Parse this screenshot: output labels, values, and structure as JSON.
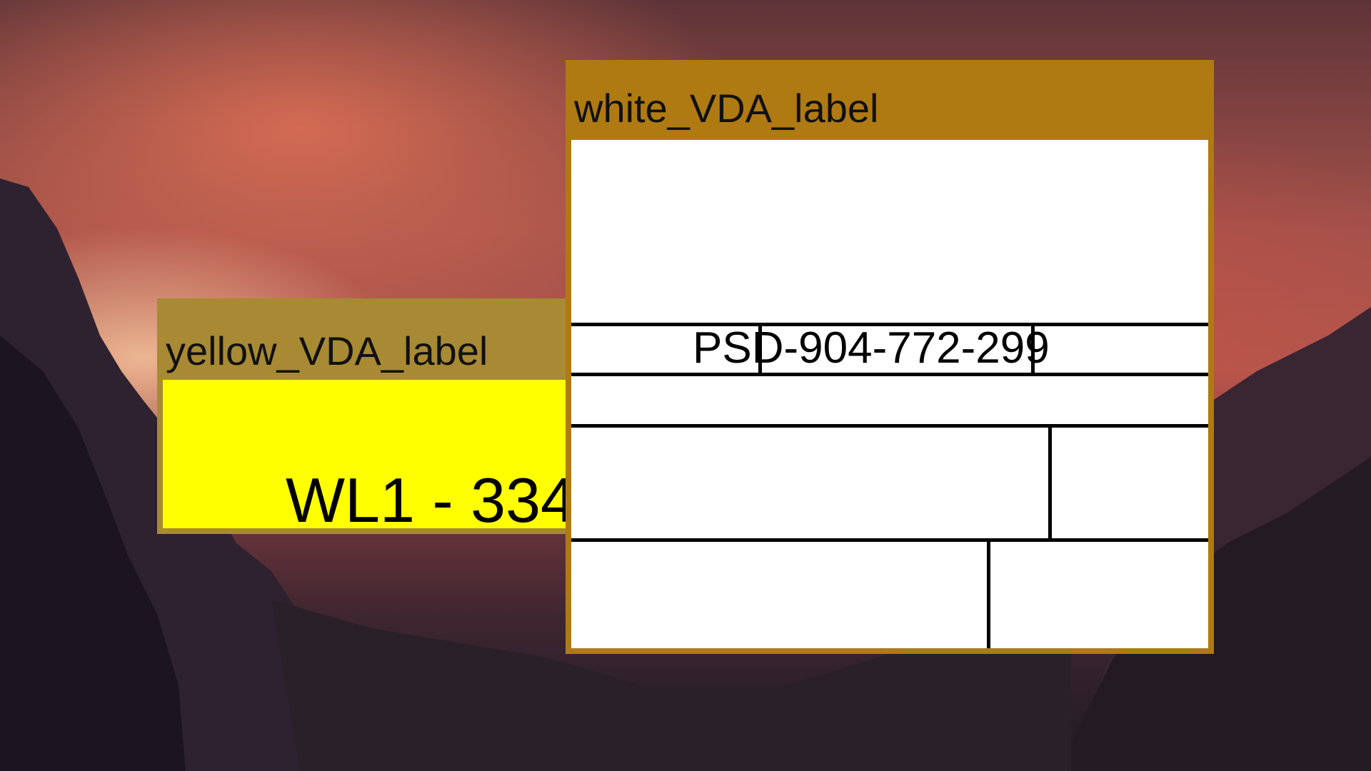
{
  "desktop": {
    "wallpaper": "sunset mountain valley",
    "colors": {
      "yellow_window_frame": "#a78a33",
      "yellow_label_fill": "#ffff00",
      "white_window_frame": "#b07a12",
      "white_label_fill": "#ffffff"
    }
  },
  "windows": {
    "yellow": {
      "title": "yellow_VDA_label",
      "code": "WL1 - 334"
    },
    "white": {
      "title": "white_VDA_label",
      "code": "PSD-904-772-299"
    }
  }
}
